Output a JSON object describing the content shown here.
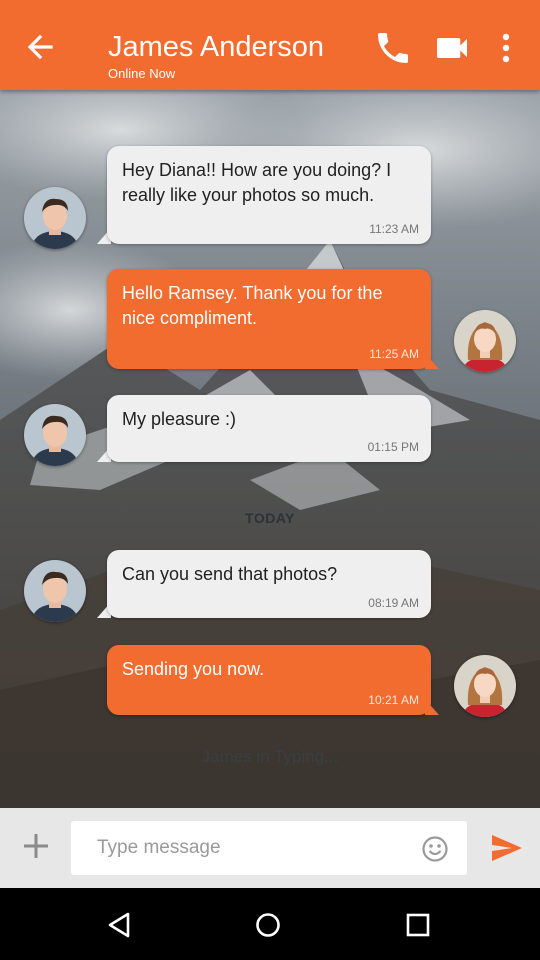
{
  "header": {
    "title": "James Anderson",
    "status": "Online Now",
    "back_icon": "arrow-left-icon",
    "call_icon": "phone-icon",
    "video_icon": "video-camera-icon",
    "menu_icon": "more-vert-icon",
    "accent": "#f26b2f"
  },
  "messages": [
    {
      "direction": "in",
      "text": "Hey Diana!!  How are you doing? I really like your photos so much.",
      "time": "11:23 AM"
    },
    {
      "direction": "out",
      "text": "Hello Ramsey. Thank you for the nice compliment.",
      "time": "11:25 AM"
    },
    {
      "direction": "in",
      "text": "My pleasure :)",
      "time": "01:15 PM"
    },
    {
      "direction": "in",
      "text": "Can you send that photos?",
      "time": "08:19 AM"
    },
    {
      "direction": "out",
      "text": "Sending you now.",
      "time": "10:21 AM"
    }
  ],
  "divider": "TODAY",
  "typing_indicator": "James in Typing...",
  "composer": {
    "placeholder": "Type message",
    "add_icon": "plus-icon",
    "emoji_icon": "smiley-icon",
    "send_icon": "send-icon"
  },
  "navigation": {
    "back_icon": "nav-back-triangle-icon",
    "home_icon": "nav-home-circle-icon",
    "recents_icon": "nav-recents-square-icon"
  }
}
